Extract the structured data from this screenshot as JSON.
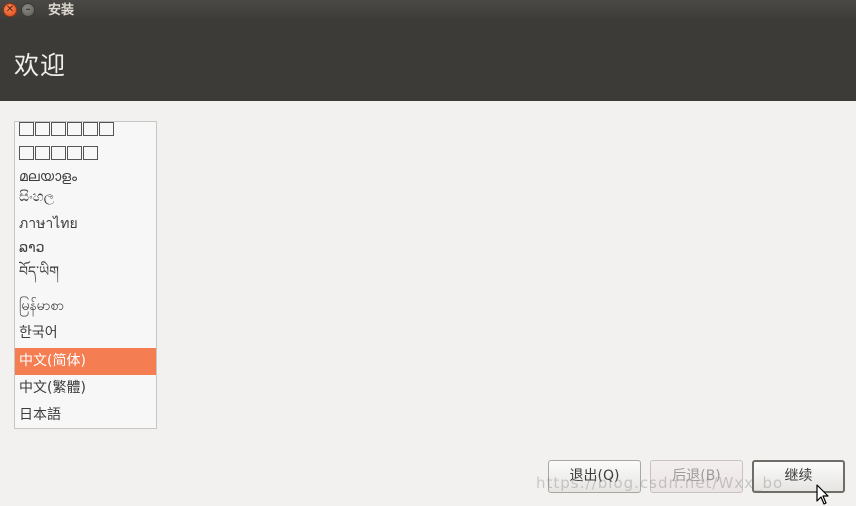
{
  "window": {
    "title": "安装"
  },
  "header": {
    "title": "欢迎"
  },
  "languages": [
    {
      "label": "",
      "icon": "unrendered-glyphs"
    },
    {
      "label": "",
      "icon": "unrendered-glyphs"
    },
    {
      "label": "മലയാളം"
    },
    {
      "label": "සිංහල"
    },
    {
      "label": "ภาษาไทย"
    },
    {
      "label": "ລາວ"
    },
    {
      "label": "བོད་ཡིག"
    },
    {
      "label": "မြန်မာစာ"
    },
    {
      "label": "한국어"
    },
    {
      "label": "中文(简体)",
      "selected": true
    },
    {
      "label": "中文(繁體)"
    },
    {
      "label": "日本語"
    }
  ],
  "buttons": {
    "quit": "退出(Q)",
    "back": "后退(B)",
    "continue": "继续"
  },
  "watermark": "https://blog.csdn.net/Wxx_bo",
  "colors": {
    "selected": "#f47d52",
    "header": "#3c3b37"
  }
}
